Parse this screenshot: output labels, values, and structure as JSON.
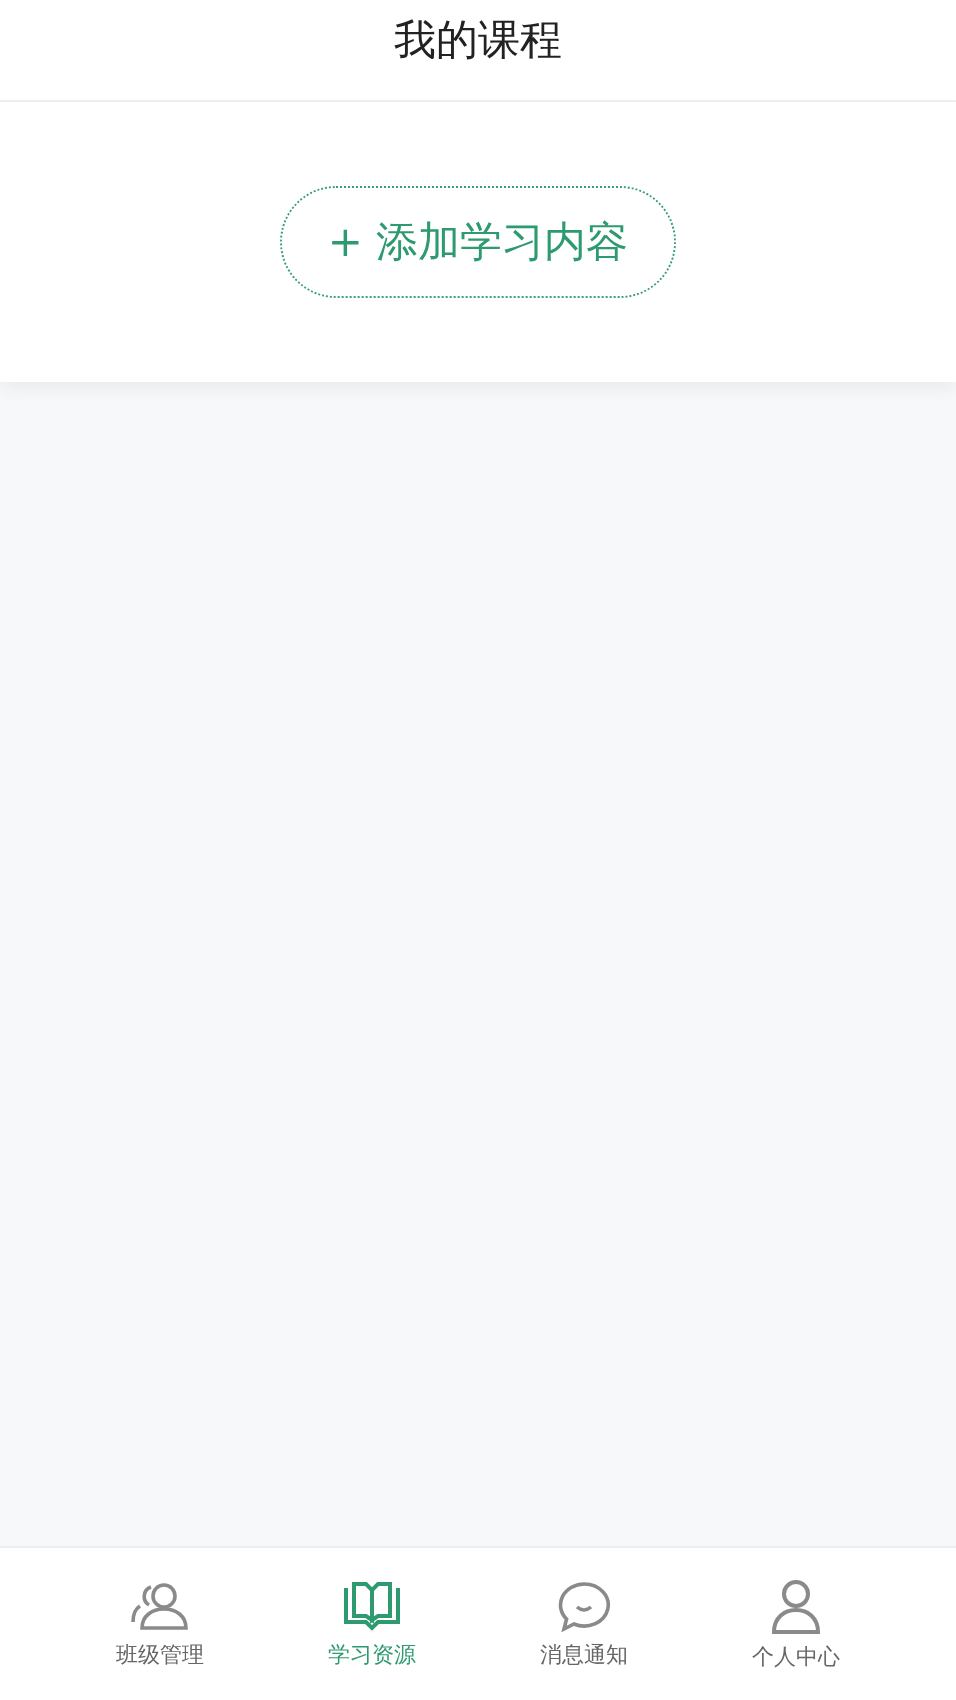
{
  "header": {
    "title": "我的课程"
  },
  "add_button": {
    "label": "+ 添加学习内容"
  },
  "tab_bar": [
    {
      "label": "班级管理",
      "kind": "group",
      "selected": false
    },
    {
      "label": "学习资源",
      "kind": "book",
      "selected": true
    },
    {
      "label": "消息通知",
      "kind": "chat",
      "selected": false
    },
    {
      "label": "个人中心",
      "kind": "person",
      "selected": false
    }
  ]
}
